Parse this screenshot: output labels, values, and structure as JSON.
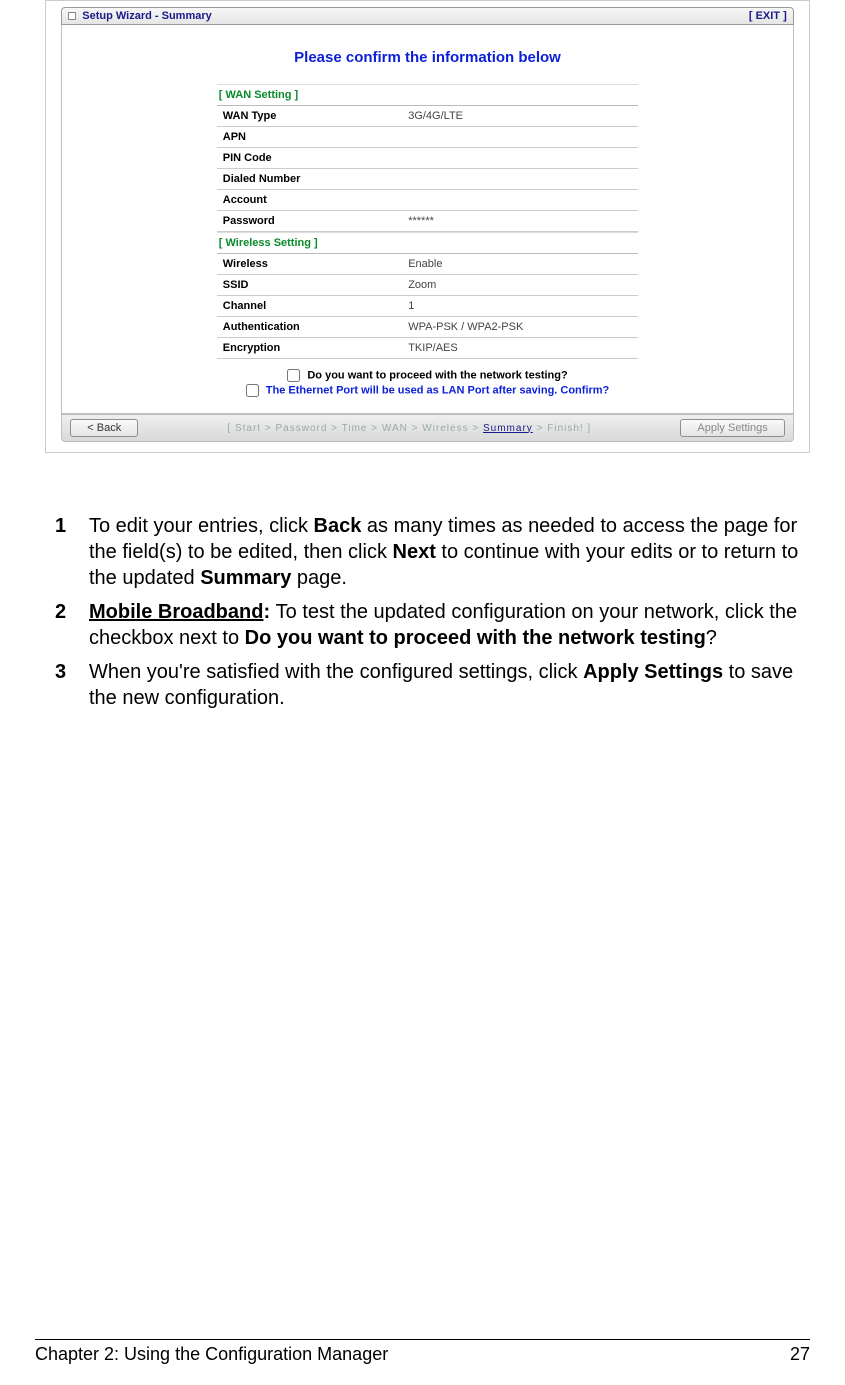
{
  "wizard": {
    "title": "Setup Wizard - Summary",
    "exit": "[ EXIT ]",
    "confirm_title": "Please confirm the information below",
    "section_wan": "[ WAN Setting ]",
    "section_wireless": "[ Wireless Setting ]",
    "wan_rows": [
      {
        "key": "WAN Type",
        "val": "3G/4G/LTE"
      },
      {
        "key": "APN",
        "val": ""
      },
      {
        "key": "PIN Code",
        "val": ""
      },
      {
        "key": "Dialed Number",
        "val": ""
      },
      {
        "key": "Account",
        "val": ""
      },
      {
        "key": "Password",
        "val": "******"
      }
    ],
    "wireless_rows": [
      {
        "key": "Wireless",
        "val": "Enable"
      },
      {
        "key": "SSID",
        "val": "Zoom"
      },
      {
        "key": "Channel",
        "val": "1"
      },
      {
        "key": "Authentication",
        "val": "WPA-PSK / WPA2-PSK"
      },
      {
        "key": "Encryption",
        "val": "TKIP/AES"
      }
    ],
    "network_test_label": "Do you want to proceed with the network testing?",
    "lan_confirm_label": "The Ethernet Port will be used as LAN Port after saving. Confirm?",
    "back_btn": "< Back",
    "apply_btn": "Apply Settings",
    "crumb": {
      "open": "[ ",
      "start": "Start",
      "password": "Password",
      "time": "Time",
      "wan": "WAN",
      "wireless": "Wireless",
      "summary": "Summary",
      "finish": "Finish!",
      "close": " ]",
      "sep": " > "
    }
  },
  "instructions": {
    "item1_num": "1",
    "item1_pre": "To edit your entries, click ",
    "item1_back": "Back",
    "item1_mid": " as many times as needed to access the page for the field(s) to be edited, then click ",
    "item1_next": "Next",
    "item1_mid2": " to continue with your edits or to return to the updated ",
    "item1_summary": "Summary",
    "item1_end": " page.",
    "item2_num": "2",
    "item2_lead": "Mobile Broadband",
    "item2_colon": ": ",
    "item2_body": "To test the updated configuration on your network, click the checkbox next to ",
    "item2_bold": "Do you want to proceed with the network testing",
    "item2_q": "?",
    "item3_num": "3",
    "item3_pre": "When you're satisfied with the configured settings, click ",
    "item3_apply": "Apply Settings",
    "item3_end": " to save the new configuration."
  },
  "footer": {
    "chapter": "Chapter 2: Using the Configuration Manager",
    "page": "27"
  }
}
